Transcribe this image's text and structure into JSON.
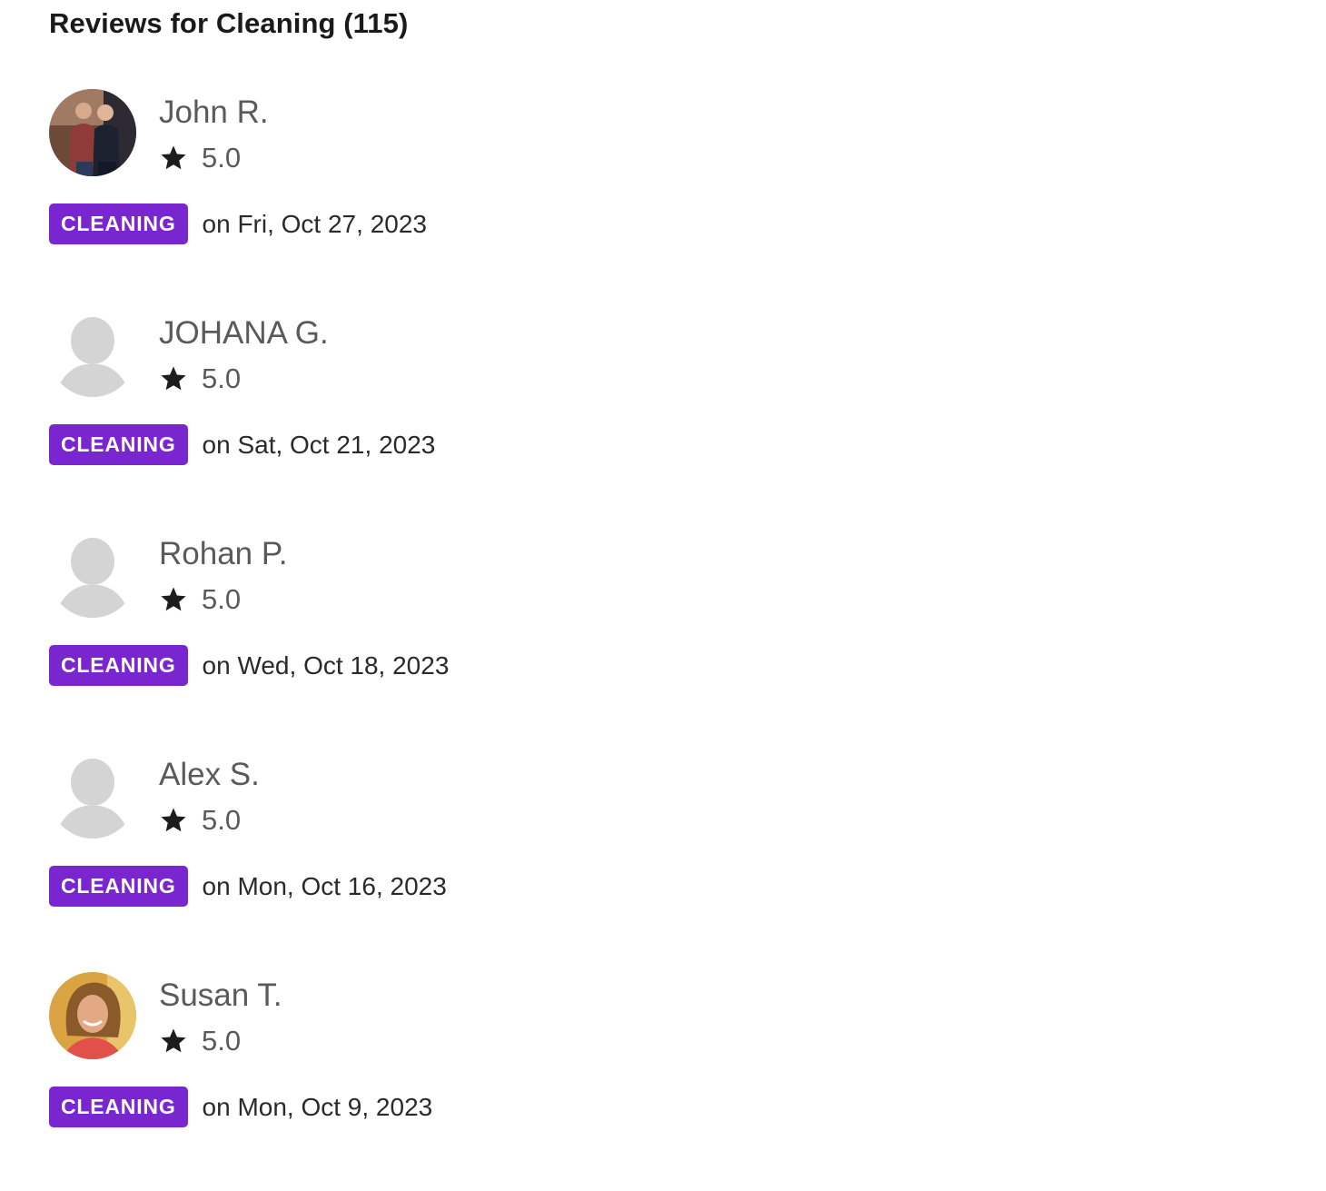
{
  "header": {
    "title": "Reviews for Cleaning (115)"
  },
  "reviews": [
    {
      "name": "John R.",
      "rating": "5.0",
      "category": "CLEANING",
      "date": "on Fri, Oct 27, 2023",
      "avatar": "photo-two-men"
    },
    {
      "name": "JOHANA G.",
      "rating": "5.0",
      "category": "CLEANING",
      "date": "on Sat, Oct 21, 2023",
      "avatar": "default-user-silhouette"
    },
    {
      "name": "Rohan P.",
      "rating": "5.0",
      "category": "CLEANING",
      "date": "on Wed, Oct 18, 2023",
      "avatar": "default-user-silhouette"
    },
    {
      "name": "Alex S.",
      "rating": "5.0",
      "category": "CLEANING",
      "date": "on Mon, Oct 16, 2023",
      "avatar": "default-user-silhouette"
    },
    {
      "name": "Susan T.",
      "rating": "5.0",
      "category": "CLEANING",
      "date": "on Mon, Oct 9, 2023",
      "avatar": "photo-woman-smiling"
    }
  ],
  "icons": {
    "rating": "star-icon"
  },
  "colors": {
    "badge_background": "#7a26d0",
    "badge_text": "#ffffff",
    "name_text": "#5a5a5a",
    "placeholder_avatar": "#d4d4d4"
  }
}
